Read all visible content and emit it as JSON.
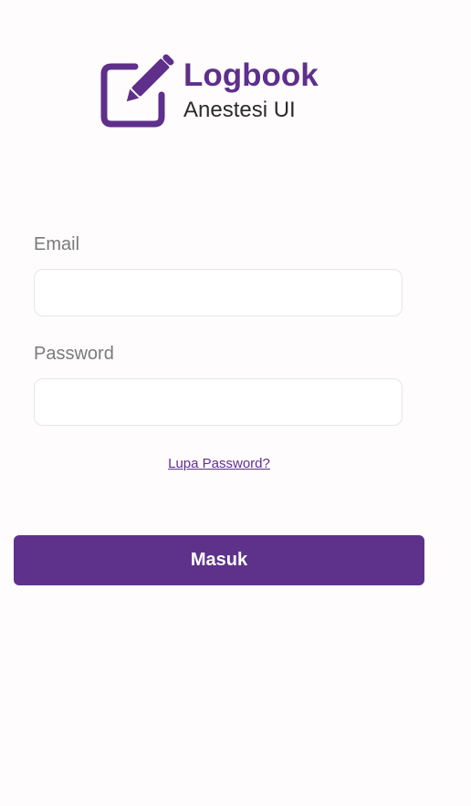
{
  "branding": {
    "title": "Logbook",
    "subtitle": "Anestesi UI",
    "icon": "edit-square-icon",
    "brand_color": "#5f2f8c"
  },
  "form": {
    "email_label": "Email",
    "email_value": "",
    "password_label": "Password",
    "password_value": "",
    "forgot_password_label": "Lupa Password?",
    "submit_label": "Masuk"
  },
  "colors": {
    "background": "#fefcfc",
    "button": "#5e328a",
    "button_text": "#ffffff",
    "label": "#7a7a7a",
    "input_border": "#e6e6e6"
  }
}
